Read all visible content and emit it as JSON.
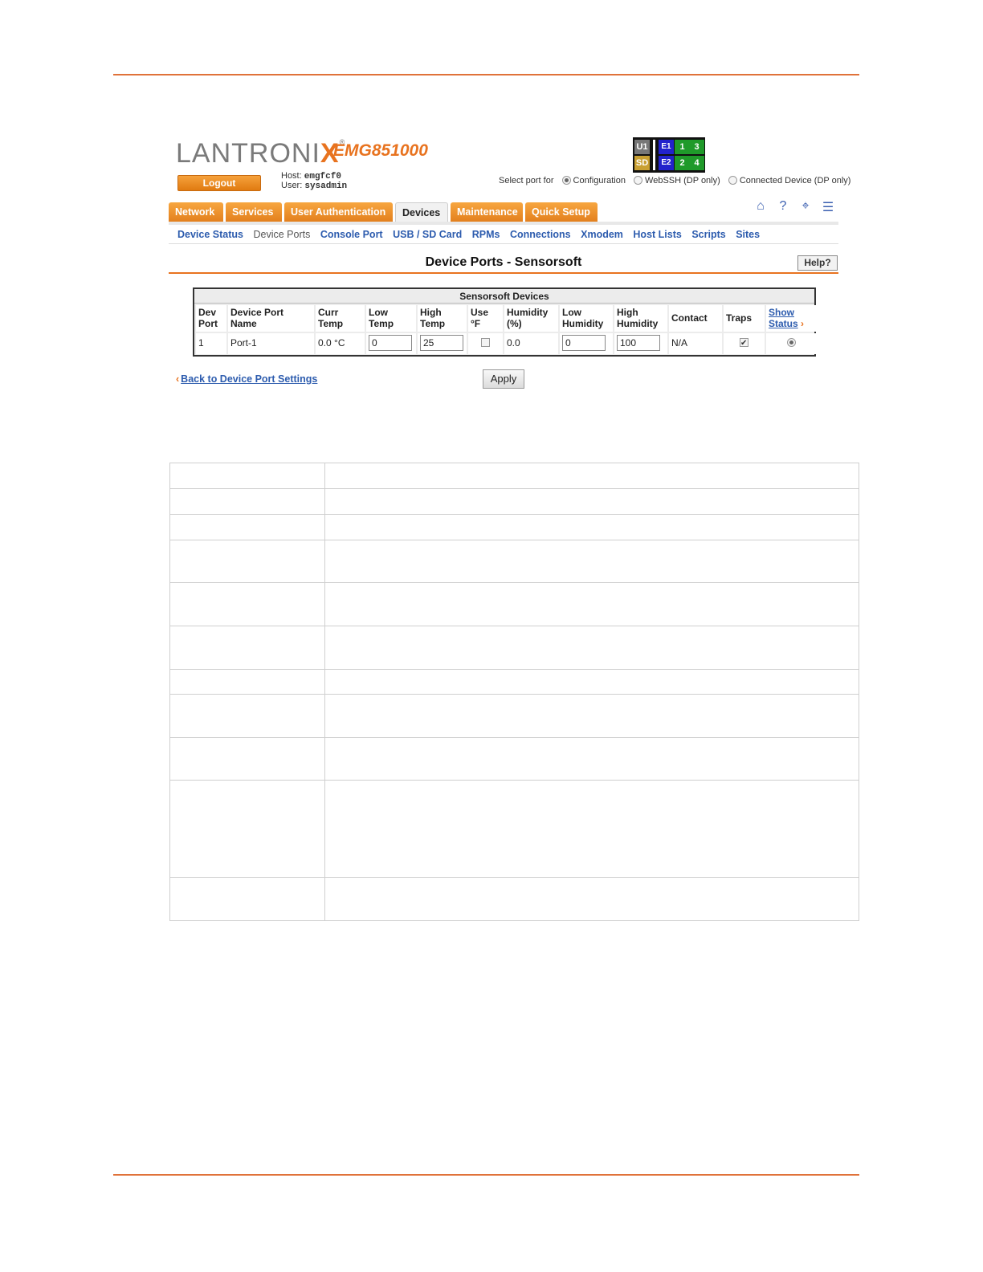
{
  "header": {
    "brand": "LANTRONIX",
    "brand_x": "X",
    "brand_prefix": "LANTRONI",
    "model": "EMG851000",
    "logout_label": "Logout",
    "host_label": "Host:",
    "host_value": "emgfcf0",
    "user_label": "User:",
    "user_value": "sysadmin"
  },
  "status_grid": {
    "u1": "U1",
    "sd": "SD",
    "e1": "E1",
    "e2": "E2",
    "p1": "1",
    "p2": "2",
    "p3": "3",
    "p4": "4"
  },
  "select_port": {
    "label": "Select port for",
    "options": [
      "Configuration",
      "WebSSH (DP only)",
      "Connected Device (DP only)"
    ],
    "selected": "Configuration"
  },
  "tabs": [
    "Network",
    "Services",
    "User Authentication",
    "Devices",
    "Maintenance",
    "Quick Setup"
  ],
  "active_tab": "Devices",
  "icons": [
    "home-icon",
    "help-icon",
    "sitemap-icon",
    "list-icon"
  ],
  "subnav": [
    "Device Status",
    "Device Ports",
    "Console Port",
    "USB / SD Card",
    "RPMs",
    "Connections",
    "Xmodem",
    "Host Lists",
    "Scripts",
    "Sites"
  ],
  "active_subnav": "Device Ports",
  "page_title": "Device Ports - Sensorsoft",
  "help_label": "Help?",
  "sensorsoft": {
    "caption": "Sensorsoft Devices",
    "headers": [
      "Dev Port",
      "Device Port Name",
      "Curr Temp",
      "Low Temp",
      "High Temp",
      "Use °F",
      "Humidity (%)",
      "Low Humidity",
      "High Humidity",
      "Contact",
      "Traps",
      "Show Status"
    ],
    "headers_line1": [
      "Dev",
      "Device Port",
      "Curr",
      "Low",
      "High",
      "Use",
      "Humidity",
      "Low",
      "High",
      "Contact",
      "Traps",
      "Show"
    ],
    "headers_line2": [
      "Port",
      "Name",
      "Temp",
      "Temp",
      "Temp",
      "°F",
      "(%)",
      "Humidity",
      "Humidity",
      "",
      "",
      "Status"
    ],
    "row": {
      "dev_port": "1",
      "name": "Port-1",
      "curr_temp": "0.0 °C",
      "low_temp": "0",
      "high_temp": "25",
      "use_f": false,
      "humidity": "0.0",
      "low_humidity": "0",
      "high_humidity": "100",
      "contact": "N/A",
      "traps": true
    }
  },
  "back_link": "Back to Device Port Settings",
  "apply_label": "Apply",
  "colors": {
    "accent": "#e8731f",
    "link": "#2d5cae"
  }
}
